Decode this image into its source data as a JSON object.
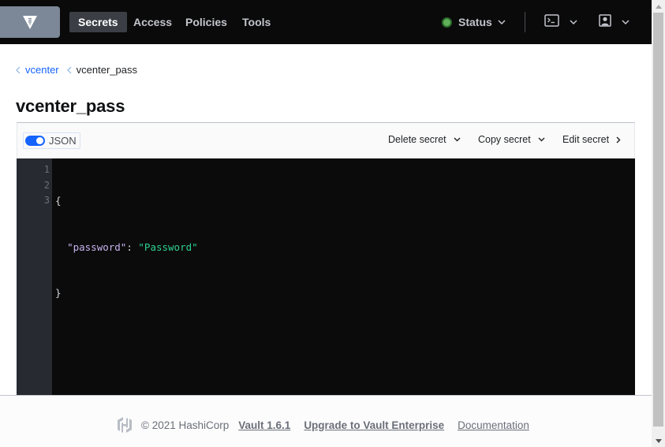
{
  "header": {
    "logo_icon": "vault-logo-icon",
    "nav_tabs": [
      {
        "label": "Secrets",
        "active": true
      },
      {
        "label": "Access",
        "active": false
      },
      {
        "label": "Policies",
        "active": false
      },
      {
        "label": "Tools",
        "active": false
      }
    ],
    "status": {
      "label": "Status",
      "state_color": "#60b05a"
    },
    "console_icon": "terminal-icon",
    "user_icon": "user-icon"
  },
  "breadcrumb": [
    {
      "label": "vcenter",
      "link": true
    },
    {
      "label": "vcenter_pass",
      "link": false
    }
  ],
  "page_title": "vcenter_pass",
  "toolbar": {
    "json_toggle": {
      "label": "JSON",
      "on": true
    },
    "delete_label": "Delete secret",
    "copy_label": "Copy secret",
    "edit_label": "Edit secret"
  },
  "editor": {
    "line_numbers": [
      "1",
      "2",
      "3"
    ],
    "lines": {
      "open_brace": "{",
      "key": "\"password\"",
      "colon": ": ",
      "value": "\"Password\"",
      "close_brace": "}"
    }
  },
  "footer": {
    "logo_icon": "hashicorp-logo-icon",
    "copyright": "© 2021 HashiCorp",
    "version_link": "Vault 1.6.1",
    "upgrade_link": "Upgrade to Vault Enterprise",
    "docs_link": "Documentation"
  },
  "colors": {
    "navbar_bg": "#0a0a0b",
    "accent": "#1563ff",
    "editor_bg": "#0b0b0b",
    "json_key": "#c7b3f0",
    "json_string": "#2ed192"
  }
}
